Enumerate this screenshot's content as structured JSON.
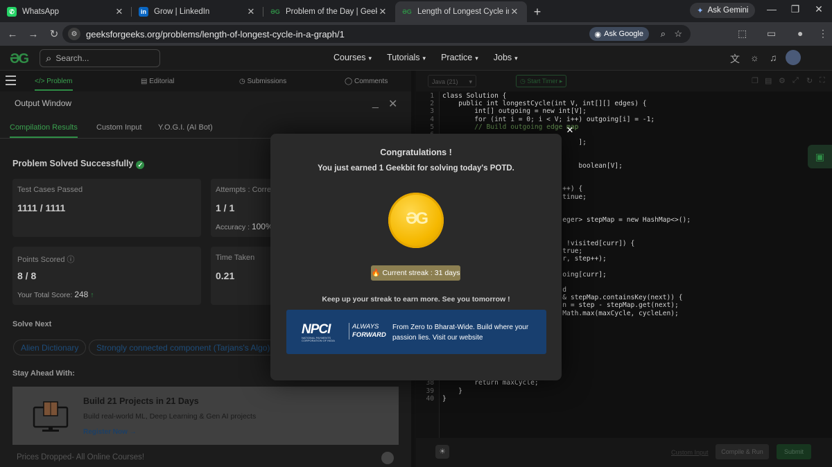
{
  "browser": {
    "tabs": [
      {
        "title": "WhatsApp",
        "favicon": "whatsapp-icon",
        "color": "#25d366"
      },
      {
        "title": "Grow | LinkedIn",
        "favicon": "linkedin-icon",
        "color": "#0a66c2"
      },
      {
        "title": "Problem of the Day | GeeksforG",
        "favicon": "gfg-icon",
        "color": "#2f8d46"
      },
      {
        "title": "Length of Longest Cycle in a Gr",
        "favicon": "gfg-icon",
        "color": "#2f8d46"
      }
    ],
    "ask_gemini": "Ask Gemini",
    "url": "geeksforgeeks.org/problems/length-of-longest-cycle-in-a-graph/1",
    "ask_google": "Ask Google"
  },
  "site": {
    "search_placeholder": "Search...",
    "nav": [
      "Courses",
      "Tutorials",
      "Practice",
      "Jobs"
    ]
  },
  "left": {
    "subtabs": [
      "Problem",
      "Editorial",
      "Submissions",
      "Comments"
    ],
    "output_title": "Output Window",
    "output_tabs": [
      "Compilation Results",
      "Custom Input",
      "Y.O.G.I. (AI Bot)"
    ],
    "status": "Problem Solved Successfully",
    "cards": {
      "tests_label": "Test Cases Passed",
      "tests_value": "1111 / 1111",
      "attempts_label": "Attempts : Correct",
      "attempts_value": "1 / 1",
      "accuracy_label": "Accuracy :",
      "accuracy_value": "100%",
      "points_label": "Points Scored",
      "points_value": "8 / 8",
      "total_label": "Your Total Score:",
      "total_value": "248",
      "time_label": "Time Taken",
      "time_value": "0.21"
    },
    "solve_next": "Solve Next",
    "next_problems": [
      "Alien Dictionary",
      "Strongly connected component (Tarjans's Algo)"
    ],
    "stay_ahead": "Stay Ahead With:",
    "banner": {
      "title": "Build 21 Projects in 21 Days",
      "desc": "Build real-world ML, Deep Learning & Gen AI projects",
      "cta": "Register Now →"
    },
    "prices": "Prices Dropped- All Online Courses!"
  },
  "editor": {
    "language": "Java (21)",
    "timer": "Start Timer",
    "lines": [
      {
        "n": "1",
        "text": "class Solution {"
      },
      {
        "n": "2",
        "text": "    public int longestCycle(int V, int[][] edges) {"
      },
      {
        "n": "3",
        "text": "        int[] outgoing = new int[V];"
      },
      {
        "n": "4",
        "text": "        for (int i = 0; i < V; i++) outgoing[i] = -1;"
      },
      {
        "n": "5",
        "text": "        // Build outgoing edge map"
      },
      {
        "n": "6",
        "text": ""
      },
      {
        "n": "7",
        "text": "                                  ];"
      },
      {
        "n": "8",
        "text": ""
      },
      {
        "n": "9",
        "text": ""
      },
      {
        "n": "10",
        "text": "                                  boolean[V];"
      },
      {
        "n": "11",
        "text": ""
      },
      {
        "n": "12",
        "text": ""
      },
      {
        "n": "13",
        "text": "                              ++) {"
      },
      {
        "n": "14",
        "text": "                              tinue;"
      },
      {
        "n": "15",
        "text": ""
      },
      {
        "n": "16",
        "text": ""
      },
      {
        "n": "17",
        "text": "                              eger> stepMap = new HashMap<>();"
      },
      {
        "n": "18",
        "text": ""
      },
      {
        "n": "19",
        "text": ""
      },
      {
        "n": "20",
        "text": "                               !visited[curr]) {"
      },
      {
        "n": "21",
        "text": "                              true;"
      },
      {
        "n": "22",
        "text": "                              r, step++);"
      },
      {
        "n": "23",
        "text": ""
      },
      {
        "n": "24",
        "text": "                              oing[curr];"
      },
      {
        "n": "25",
        "text": ""
      },
      {
        "n": "26",
        "text": "                              d"
      },
      {
        "n": "27",
        "text": "                              & stepMap.containsKey(next)) {"
      },
      {
        "n": "28",
        "text": "                              n = step - stepMap.get(next);"
      },
      {
        "n": "29",
        "text": "                              Math.max(maxCycle, cycleLen);"
      },
      {
        "n": "30",
        "text": ""
      },
      {
        "n": "31",
        "text": ""
      },
      {
        "n": "32",
        "text": ""
      },
      {
        "n": "33",
        "text": ""
      },
      {
        "n": "34",
        "text": ""
      },
      {
        "n": "35",
        "text": ""
      },
      {
        "n": "36",
        "text": ""
      },
      {
        "n": "37",
        "text": ""
      },
      {
        "n": "38",
        "text": "        return maxCycle;"
      },
      {
        "n": "39",
        "text": "    }"
      },
      {
        "n": "40",
        "text": "}"
      }
    ],
    "custom_input": "Custom Input",
    "compile_run": "Compile & Run",
    "submit": "Submit"
  },
  "modal": {
    "title": "Congratulations !",
    "subtitle": "You just earned 1 Geekbit for solving today's POTD.",
    "streak": "Current streak : 31 days",
    "keep": "Keep up your streak to earn more. See you tomorrow !",
    "ad": {
      "logo": "NPCI",
      "logo_sub": "NATIONAL PAYMENTS CORPORATION OF INDIA",
      "tag1": "ALWAYS",
      "tag2": "FORWARD",
      "text": "From Zero to Bharat-Wide. Build where your passion lies. Visit our website"
    }
  },
  "colors": {
    "brand": "#2f8d46",
    "modal_bg": "#2a2a2a",
    "ad_bg": "#183f6f"
  }
}
